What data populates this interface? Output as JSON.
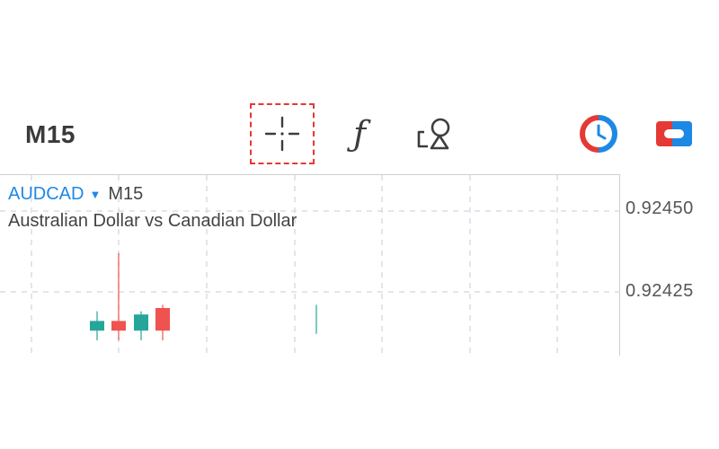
{
  "toolbar": {
    "timeframe": "M15",
    "tools": [
      {
        "id": "crosshair",
        "icon": "crosshair-icon",
        "selected": true
      },
      {
        "id": "indicators",
        "icon": "function-icon",
        "glyph": "ƒ"
      },
      {
        "id": "drawing",
        "icon": "shapes-icon"
      },
      {
        "id": "clock",
        "icon": "clock-icon"
      },
      {
        "id": "trade",
        "icon": "trade-icon"
      }
    ],
    "colors": {
      "selection_border": "#e53935",
      "icon": "#3d3d3d",
      "clock_red": "#e53935",
      "clock_blue": "#1e88e5",
      "trade_red": "#e53935",
      "trade_blue": "#1e88e5"
    }
  },
  "chart": {
    "symbol": "AUDCAD",
    "symbol_caret": "▼",
    "timeframe": "M15",
    "description": "Australian Dollar vs Canadian Dollar",
    "price_labels": [
      "0.92450",
      "0.92425"
    ],
    "colors": {
      "bull": "#26a69a",
      "bear": "#ef5350",
      "grid": "#d8dde3",
      "axis": "#cfcfcf",
      "symbol": "#1e88e5"
    }
  },
  "chart_data": {
    "type": "candlestick",
    "symbol": "AUDCAD",
    "timeframe": "M15",
    "y_ticks": [
      0.9245,
      0.92425
    ],
    "candles": [
      {
        "direction": "up",
        "open": 0.92413,
        "close": 0.92416,
        "high": 0.92419,
        "low": 0.9241
      },
      {
        "direction": "down",
        "open": 0.92416,
        "close": 0.92413,
        "high": 0.92437,
        "low": 0.9241
      },
      {
        "direction": "up",
        "open": 0.92413,
        "close": 0.92418,
        "high": 0.92419,
        "low": 0.9241
      },
      {
        "direction": "down",
        "open": 0.9242,
        "close": 0.92413,
        "high": 0.92421,
        "low": 0.9241
      },
      {
        "direction": "up",
        "open": 0.92413,
        "close": 0.92413,
        "high": 0.92421,
        "low": 0.92412
      }
    ]
  }
}
